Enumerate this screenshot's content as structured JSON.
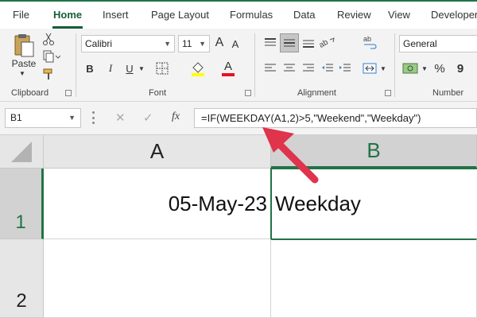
{
  "tabs": [
    "File",
    "Home",
    "Insert",
    "Page Layout",
    "Formulas",
    "Data",
    "Review",
    "View",
    "Developer"
  ],
  "ribbon": {
    "clipboard": {
      "label": "Clipboard",
      "paste_label": "Paste"
    },
    "font": {
      "label": "Font",
      "font_name": "Calibri",
      "font_size": "11",
      "bold": "B",
      "italic": "I",
      "underline": "U",
      "grow": "A",
      "shrink": "A",
      "font_color_glyph": "A"
    },
    "alignment": {
      "label": "Alignment"
    },
    "number": {
      "label": "Number",
      "format": "General",
      "currency": "$",
      "percent": "%",
      "comma": "9"
    }
  },
  "formula_bar": {
    "name_box": "B1",
    "cancel": "✕",
    "enter": "✓",
    "fx": "fx",
    "formula": "=IF(WEEKDAY(A1,2)>5,\"Weekend\",\"Weekday\")"
  },
  "grid": {
    "columns": [
      "A",
      "B"
    ],
    "rows": [
      "1",
      "2"
    ],
    "cells": {
      "A1": "05-May-23",
      "B1": "Weekday"
    }
  },
  "colors": {
    "accent": "#217346",
    "arrow": "#e0334c"
  }
}
